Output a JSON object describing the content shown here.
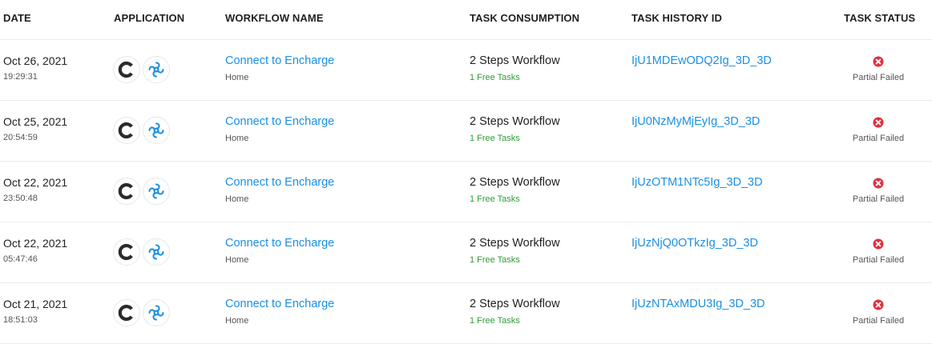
{
  "columns": {
    "date": "DATE",
    "application": "APPLICATION",
    "workflow_name": "WORKFLOW NAME",
    "task_consumption": "TASK CONSUMPTION",
    "task_history_id": "TASK HISTORY ID",
    "task_status": "TASK STATUS"
  },
  "colors": {
    "link": "#1a8fe3",
    "free_tasks": "#2e9b36",
    "failed": "#e0303f",
    "divider": "#e6eef3"
  },
  "app_icons": [
    "encharge-logo-icon",
    "sendinblue-logo-icon"
  ],
  "status_icon": "error-circle-icon",
  "rows": [
    {
      "date": "Oct 26, 2021",
      "time": "19:29:31",
      "workflow": "Connect to Encharge",
      "folder": "Home",
      "steps": "2 Steps Workflow",
      "free_tasks": "1 Free Tasks",
      "history_id": "IjU1MDEwODQ2Ig_3D_3D",
      "status": "Partial Failed"
    },
    {
      "date": "Oct 25, 2021",
      "time": "20:54:59",
      "workflow": "Connect to Encharge",
      "folder": "Home",
      "steps": "2 Steps Workflow",
      "free_tasks": "1 Free Tasks",
      "history_id": "IjU0NzMyMjEyIg_3D_3D",
      "status": "Partial Failed"
    },
    {
      "date": "Oct 22, 2021",
      "time": "23:50:48",
      "workflow": "Connect to Encharge",
      "folder": "Home",
      "steps": "2 Steps Workflow",
      "free_tasks": "1 Free Tasks",
      "history_id": "IjUzOTM1NTc5Ig_3D_3D",
      "status": "Partial Failed"
    },
    {
      "date": "Oct 22, 2021",
      "time": "05:47:46",
      "workflow": "Connect to Encharge",
      "folder": "Home",
      "steps": "2 Steps Workflow",
      "free_tasks": "1 Free Tasks",
      "history_id": "IjUzNjQ0OTkzIg_3D_3D",
      "status": "Partial Failed"
    },
    {
      "date": "Oct 21, 2021",
      "time": "18:51:03",
      "workflow": "Connect to Encharge",
      "folder": "Home",
      "steps": "2 Steps Workflow",
      "free_tasks": "1 Free Tasks",
      "history_id": "IjUzNTAxMDU3Ig_3D_3D",
      "status": "Partial Failed"
    }
  ]
}
